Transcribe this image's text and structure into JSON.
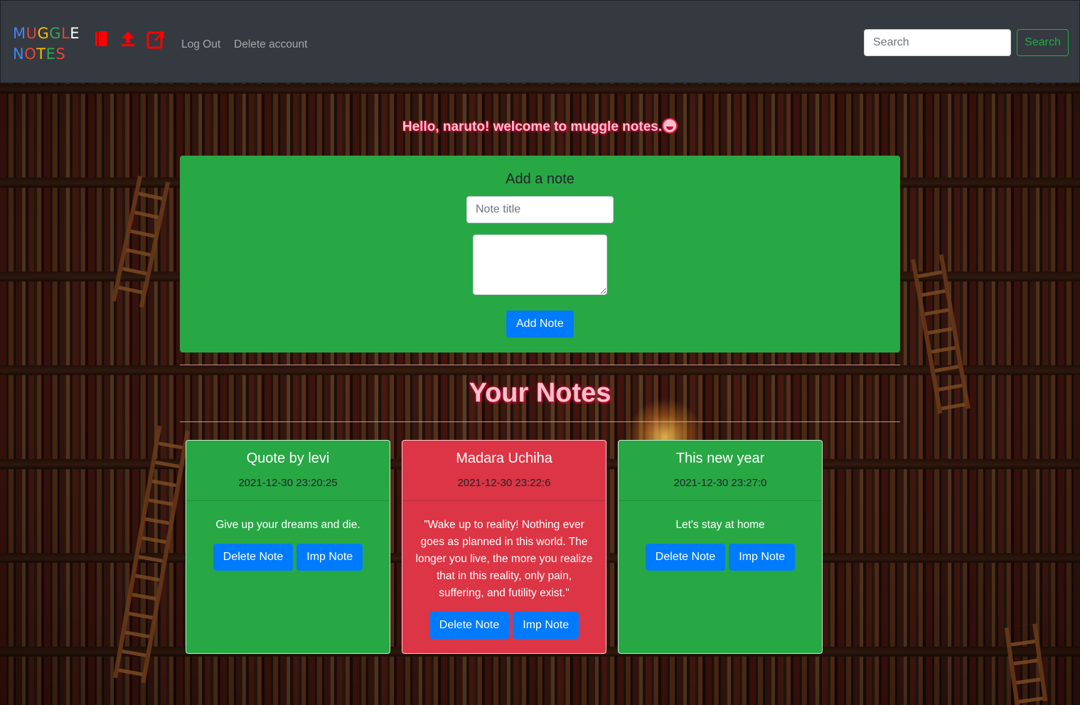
{
  "brand": {
    "line1": [
      {
        "ch": "M",
        "color": "#4285f4"
      },
      {
        "ch": "U",
        "color": "#ea4335"
      },
      {
        "ch": "G",
        "color": "#fbbc05"
      },
      {
        "ch": "G",
        "color": "#34a853"
      },
      {
        "ch": "L",
        "color": "#ea4335"
      },
      {
        "ch": "E",
        "color": "#ffffff"
      }
    ],
    "line2": [
      {
        "ch": "N",
        "color": "#4285f4"
      },
      {
        "ch": "O",
        "color": "#ea4335"
      },
      {
        "ch": "T",
        "color": "#fbbc05"
      },
      {
        "ch": "E",
        "color": "#34a853"
      },
      {
        "ch": "S",
        "color": "#ea4335"
      }
    ]
  },
  "nav": {
    "icons": [
      "book-icon",
      "upload-icon",
      "external-link-icon"
    ],
    "icon_color": "#ff0000",
    "logout_label": "Log Out",
    "delete_account_label": "Delete account"
  },
  "search": {
    "placeholder": "Search",
    "value": "",
    "button_label": "Search"
  },
  "greeting": "Hello, naruto! welcome to muggle notes.",
  "add_note": {
    "heading": "Add a note",
    "title_placeholder": "Note title",
    "body_value": "",
    "button_label": "Add Note"
  },
  "notes_heading": "Your Notes",
  "notes": [
    {
      "title": "Quote by levi",
      "date": "2021-12-30 23:20:25",
      "text": "Give up your dreams and die.",
      "color": "green",
      "delete_label": "Delete Note",
      "imp_label": "Imp Note"
    },
    {
      "title": "Madara Uchiha",
      "date": "2021-12-30 23:22:6",
      "text": "\"Wake up to reality! Nothing ever goes as planned in this world. The longer you live, the more you realize that in this reality, only pain, suffering, and futility exist.\"",
      "color": "red",
      "delete_label": "Delete Note",
      "imp_label": "Imp Note"
    },
    {
      "title": "This new year",
      "date": "2021-12-30 23:27:0",
      "text": "Let's stay at home",
      "color": "green",
      "delete_label": "Delete Note",
      "imp_label": "Imp Note"
    }
  ],
  "colors": {
    "navbar": "#343a40",
    "green": "#28a745",
    "red": "#dc3545",
    "primary": "#007bff",
    "heading_pink": "#ffc0cb"
  }
}
